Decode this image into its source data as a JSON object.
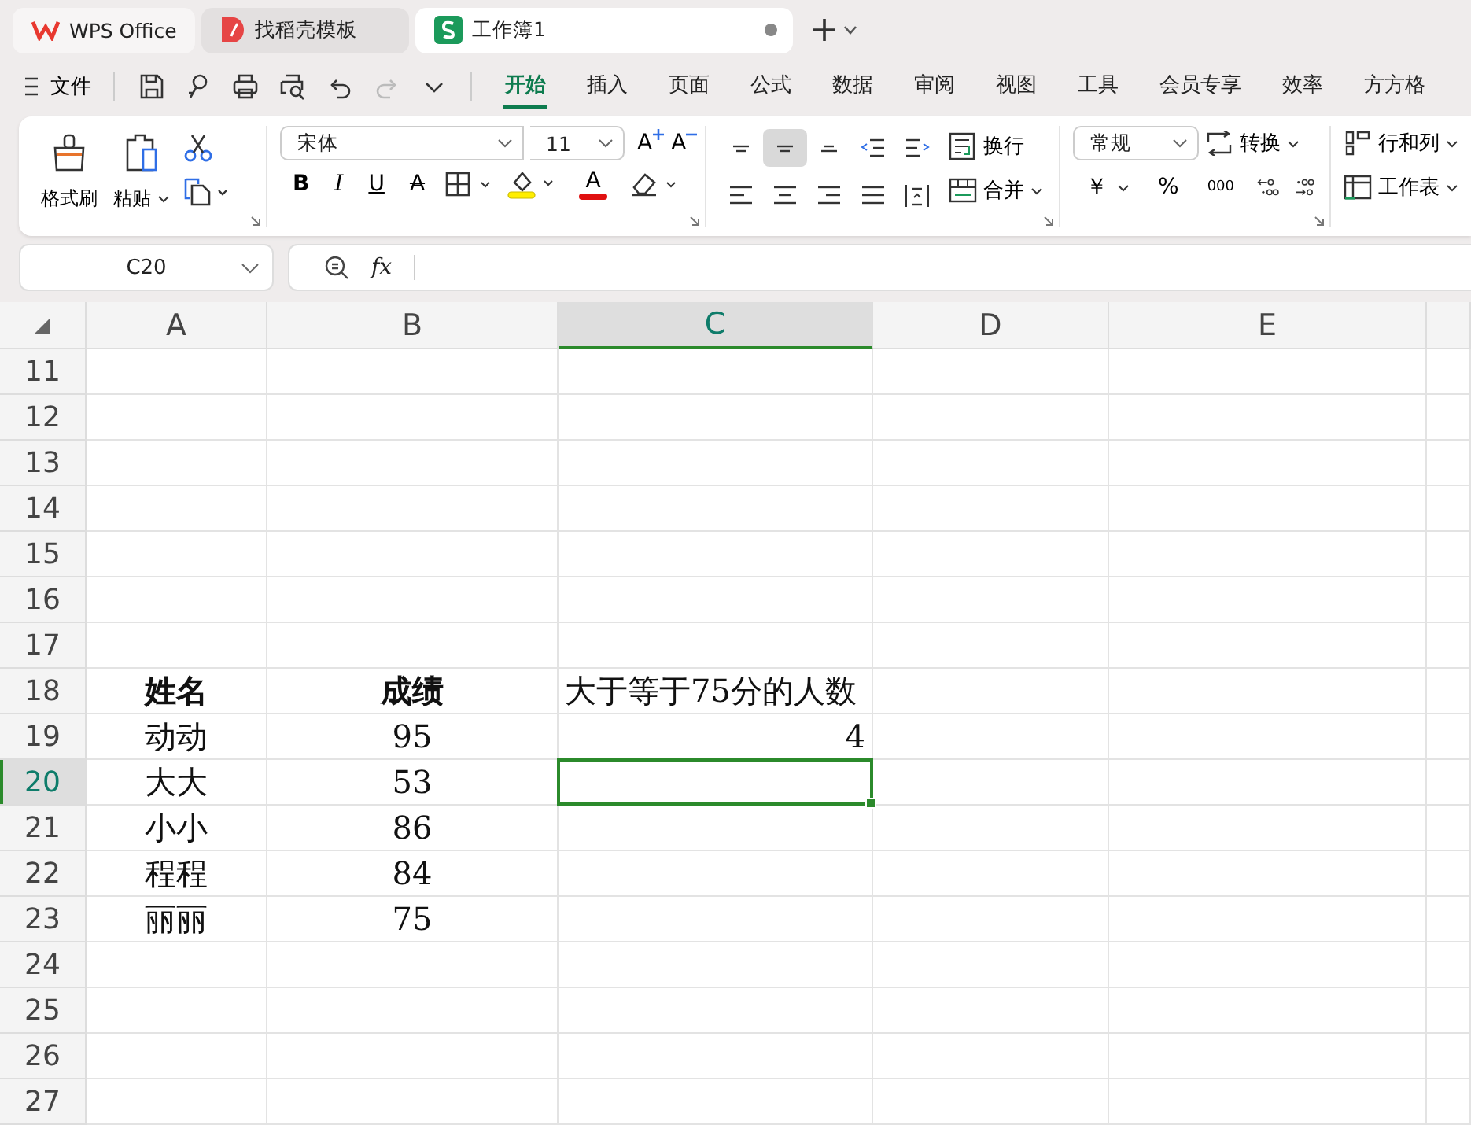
{
  "tabs": [
    {
      "title": "WPS Office",
      "kind": "wps",
      "selected": false,
      "modified": false
    },
    {
      "title": "找稻壳模板",
      "kind": "template",
      "selected": false,
      "modified": false
    },
    {
      "title": "工作簿1",
      "kind": "sheet",
      "selected": true,
      "modified": true
    }
  ],
  "menu": {
    "file": "文件"
  },
  "quick_access": [
    {
      "kind": "save",
      "disabled": false
    },
    {
      "kind": "export",
      "disabled": false
    },
    {
      "kind": "print",
      "disabled": false
    },
    {
      "kind": "preview",
      "disabled": false
    },
    {
      "kind": "undo",
      "disabled": false
    },
    {
      "kind": "redo",
      "disabled": true
    },
    {
      "kind": "more",
      "disabled": false
    }
  ],
  "ribbon_tabs": [
    {
      "label": "开始",
      "selected": true
    },
    {
      "label": "插入",
      "selected": false
    },
    {
      "label": "页面",
      "selected": false
    },
    {
      "label": "公式",
      "selected": false
    },
    {
      "label": "数据",
      "selected": false
    },
    {
      "label": "审阅",
      "selected": false
    },
    {
      "label": "视图",
      "selected": false
    },
    {
      "label": "工具",
      "selected": false
    },
    {
      "label": "会员专享",
      "selected": false
    },
    {
      "label": "效率",
      "selected": false
    },
    {
      "label": "方方格",
      "selected": false
    }
  ],
  "clipboard": {
    "format_painter": "格式刷",
    "paste": "粘贴"
  },
  "font": {
    "name": "宋体",
    "size": "11",
    "grow": "A",
    "shrink": "A",
    "bold": "B",
    "italic": "I",
    "underline": "U",
    "strike": "A",
    "font_color": "A"
  },
  "alignment": {
    "buttons": [
      {
        "kind": "top",
        "selected": false
      },
      {
        "kind": "middle",
        "selected": true
      },
      {
        "kind": "bottom",
        "selected": false
      },
      {
        "kind": "outdent",
        "selected": false
      },
      {
        "kind": "indent",
        "selected": false
      },
      {
        "kind": "left",
        "selected": false
      },
      {
        "kind": "center",
        "selected": false
      },
      {
        "kind": "right",
        "selected": false
      },
      {
        "kind": "justify",
        "selected": false
      },
      {
        "kind": "distributed",
        "selected": false
      }
    ],
    "wrap": "换行",
    "merge": "合并"
  },
  "number": {
    "format": "常规",
    "convert": "转换",
    "currency": "￥",
    "percent": "%",
    "thousands": "000"
  },
  "cells": {
    "rows_columns": "行和列",
    "worksheet": "工作表"
  },
  "name_box": "C20",
  "formula_label": "fx",
  "columns": [
    {
      "label": "A",
      "selected": false
    },
    {
      "label": "B",
      "selected": false
    },
    {
      "label": "C",
      "selected": true
    },
    {
      "label": "D",
      "selected": false
    },
    {
      "label": "E",
      "selected": false
    }
  ],
  "rows": [
    {
      "number": "11",
      "selected": false,
      "cells": []
    },
    {
      "number": "12",
      "selected": false,
      "cells": []
    },
    {
      "number": "13",
      "selected": false,
      "cells": []
    },
    {
      "number": "14",
      "selected": false,
      "cells": []
    },
    {
      "number": "15",
      "selected": false,
      "cells": []
    },
    {
      "number": "16",
      "selected": false,
      "cells": []
    },
    {
      "number": "17",
      "selected": false,
      "cells": []
    },
    {
      "number": "18",
      "selected": false,
      "cells": [
        {
          "text": "姓名",
          "bold": true,
          "kind": "center"
        },
        {
          "text": "成绩",
          "bold": true,
          "kind": "center"
        },
        {
          "text": "大于等于75分的人数",
          "bold": false,
          "kind": "left"
        }
      ]
    },
    {
      "number": "19",
      "selected": false,
      "cells": [
        {
          "text": "动动",
          "bold": false,
          "kind": "center"
        },
        {
          "text": "95",
          "bold": false,
          "kind": "center"
        },
        {
          "text": "4",
          "bold": false,
          "kind": "right"
        }
      ]
    },
    {
      "number": "20",
      "selected": true,
      "cells": [
        {
          "text": "大大",
          "bold": false,
          "kind": "center"
        },
        {
          "text": "53",
          "bold": false,
          "kind": "center"
        }
      ]
    },
    {
      "number": "21",
      "selected": false,
      "cells": [
        {
          "text": "小小",
          "bold": false,
          "kind": "center"
        },
        {
          "text": "86",
          "bold": false,
          "kind": "center"
        }
      ]
    },
    {
      "number": "22",
      "selected": false,
      "cells": [
        {
          "text": "程程",
          "bold": false,
          "kind": "center"
        },
        {
          "text": "84",
          "bold": false,
          "kind": "center"
        }
      ]
    },
    {
      "number": "23",
      "selected": false,
      "cells": [
        {
          "text": "丽丽",
          "bold": false,
          "kind": "center"
        },
        {
          "text": "75",
          "bold": false,
          "kind": "center"
        }
      ]
    },
    {
      "number": "24",
      "selected": false,
      "cells": []
    },
    {
      "number": "25",
      "selected": false,
      "cells": []
    },
    {
      "number": "26",
      "selected": false,
      "cells": []
    },
    {
      "number": "27",
      "selected": false,
      "cells": []
    }
  ]
}
